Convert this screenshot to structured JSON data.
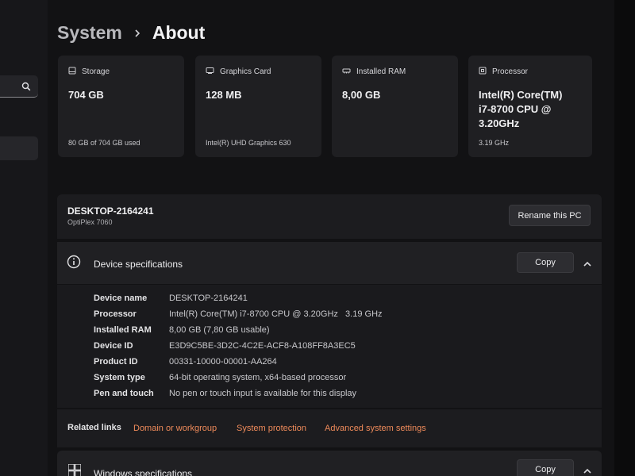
{
  "breadcrumb": {
    "parent": "System",
    "current": "About"
  },
  "tiles": [
    {
      "label": "Storage",
      "value": "704 GB",
      "sub": "80 GB of 704 GB used",
      "icon": "storage-icon"
    },
    {
      "label": "Graphics Card",
      "value": "128 MB",
      "sub": "Intel(R) UHD Graphics 630",
      "icon": "graphics-card-icon"
    },
    {
      "label": "Installed RAM",
      "value": "8,00 GB",
      "sub": "",
      "icon": "ram-icon"
    },
    {
      "label": "Processor",
      "value": "Intel(R) Core(TM) i7-8700 CPU @ 3.20GHz",
      "sub": "3.19 GHz",
      "icon": "processor-icon"
    }
  ],
  "pc": {
    "name": "DESKTOP-2164241",
    "model": "OptiPlex 7060",
    "rename_label": "Rename this PC"
  },
  "device_specs": {
    "title": "Device specifications",
    "copy_label": "Copy",
    "rows": [
      {
        "k": "Device name",
        "v": "DESKTOP-2164241"
      },
      {
        "k": "Processor",
        "v": "Intel(R) Core(TM) i7-8700 CPU @ 3.20GHz   3.19 GHz"
      },
      {
        "k": "Installed RAM",
        "v": "8,00 GB (7,80 GB usable)"
      },
      {
        "k": "Device ID",
        "v": "E3D9C5BE-3D2C-4C2E-ACF8-A108FF8A3EC5"
      },
      {
        "k": "Product ID",
        "v": "00331-10000-00001-AA264"
      },
      {
        "k": "System type",
        "v": "64-bit operating system, x64-based processor"
      },
      {
        "k": "Pen and touch",
        "v": "No pen or touch input is available for this display"
      }
    ]
  },
  "related": {
    "label": "Related links",
    "links": [
      "Domain or workgroup",
      "System protection",
      "Advanced system settings"
    ]
  },
  "windows_specs": {
    "title": "Windows specifications",
    "copy_label": "Copy"
  },
  "colors": {
    "accent_link": "#ee8a5a",
    "background": "#121214",
    "card": "#1c1c1f"
  }
}
